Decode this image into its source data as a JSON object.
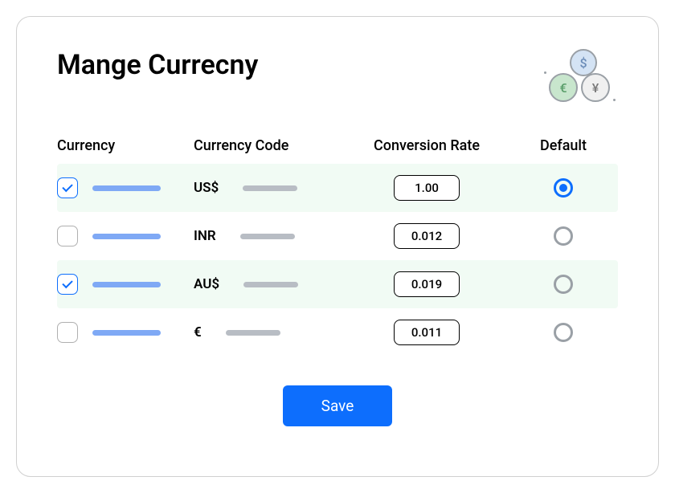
{
  "title": "Mange Currecny",
  "columns": {
    "currency": "Currency",
    "code": "Currency Code",
    "rate": "Conversion Rate",
    "default": "Default"
  },
  "rows": [
    {
      "checked": true,
      "code": "US$",
      "rate": "1.00",
      "default": true
    },
    {
      "checked": false,
      "code": "INR",
      "rate": "0.012",
      "default": false
    },
    {
      "checked": true,
      "code": "AU$",
      "rate": "0.019",
      "default": false
    },
    {
      "checked": false,
      "code": "€",
      "rate": "0.011",
      "default": false
    }
  ],
  "save_label": "Save",
  "icons": {
    "dollar": "$",
    "euro": "€",
    "yen": "¥"
  }
}
